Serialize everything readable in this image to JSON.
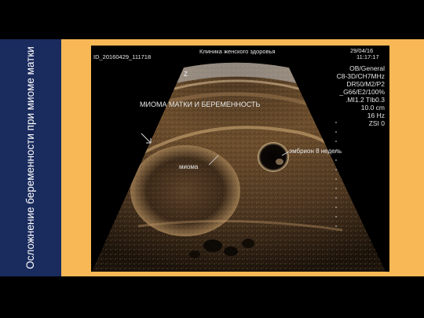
{
  "slide": {
    "sidebar_title": "Осложнение беременности при миоме матки",
    "colors": {
      "background": "#000000",
      "band": "#f8b856",
      "sidebar": "#1a2b5e"
    }
  },
  "ultrasound": {
    "patient_id": "ID_20160429_111718",
    "clinic": "Клиника женского здоровья",
    "date": "29/04/16",
    "time": "11:17:17",
    "orientation_marker": "Z",
    "params": [
      "OB/General",
      "C8-3D/CH7MHz",
      "DR50/M2/P2",
      "_G66/E2/100%",
      ".MI1.2  TIb0.3",
      "10.0 cm",
      "16 Hz",
      "ZSI 0"
    ],
    "annotations": {
      "title": "МИОМА МАТКИ И БЕРЕМЕННОСТЬ",
      "myoma": "миома",
      "embryo": "эмбрион 8 недель"
    }
  }
}
